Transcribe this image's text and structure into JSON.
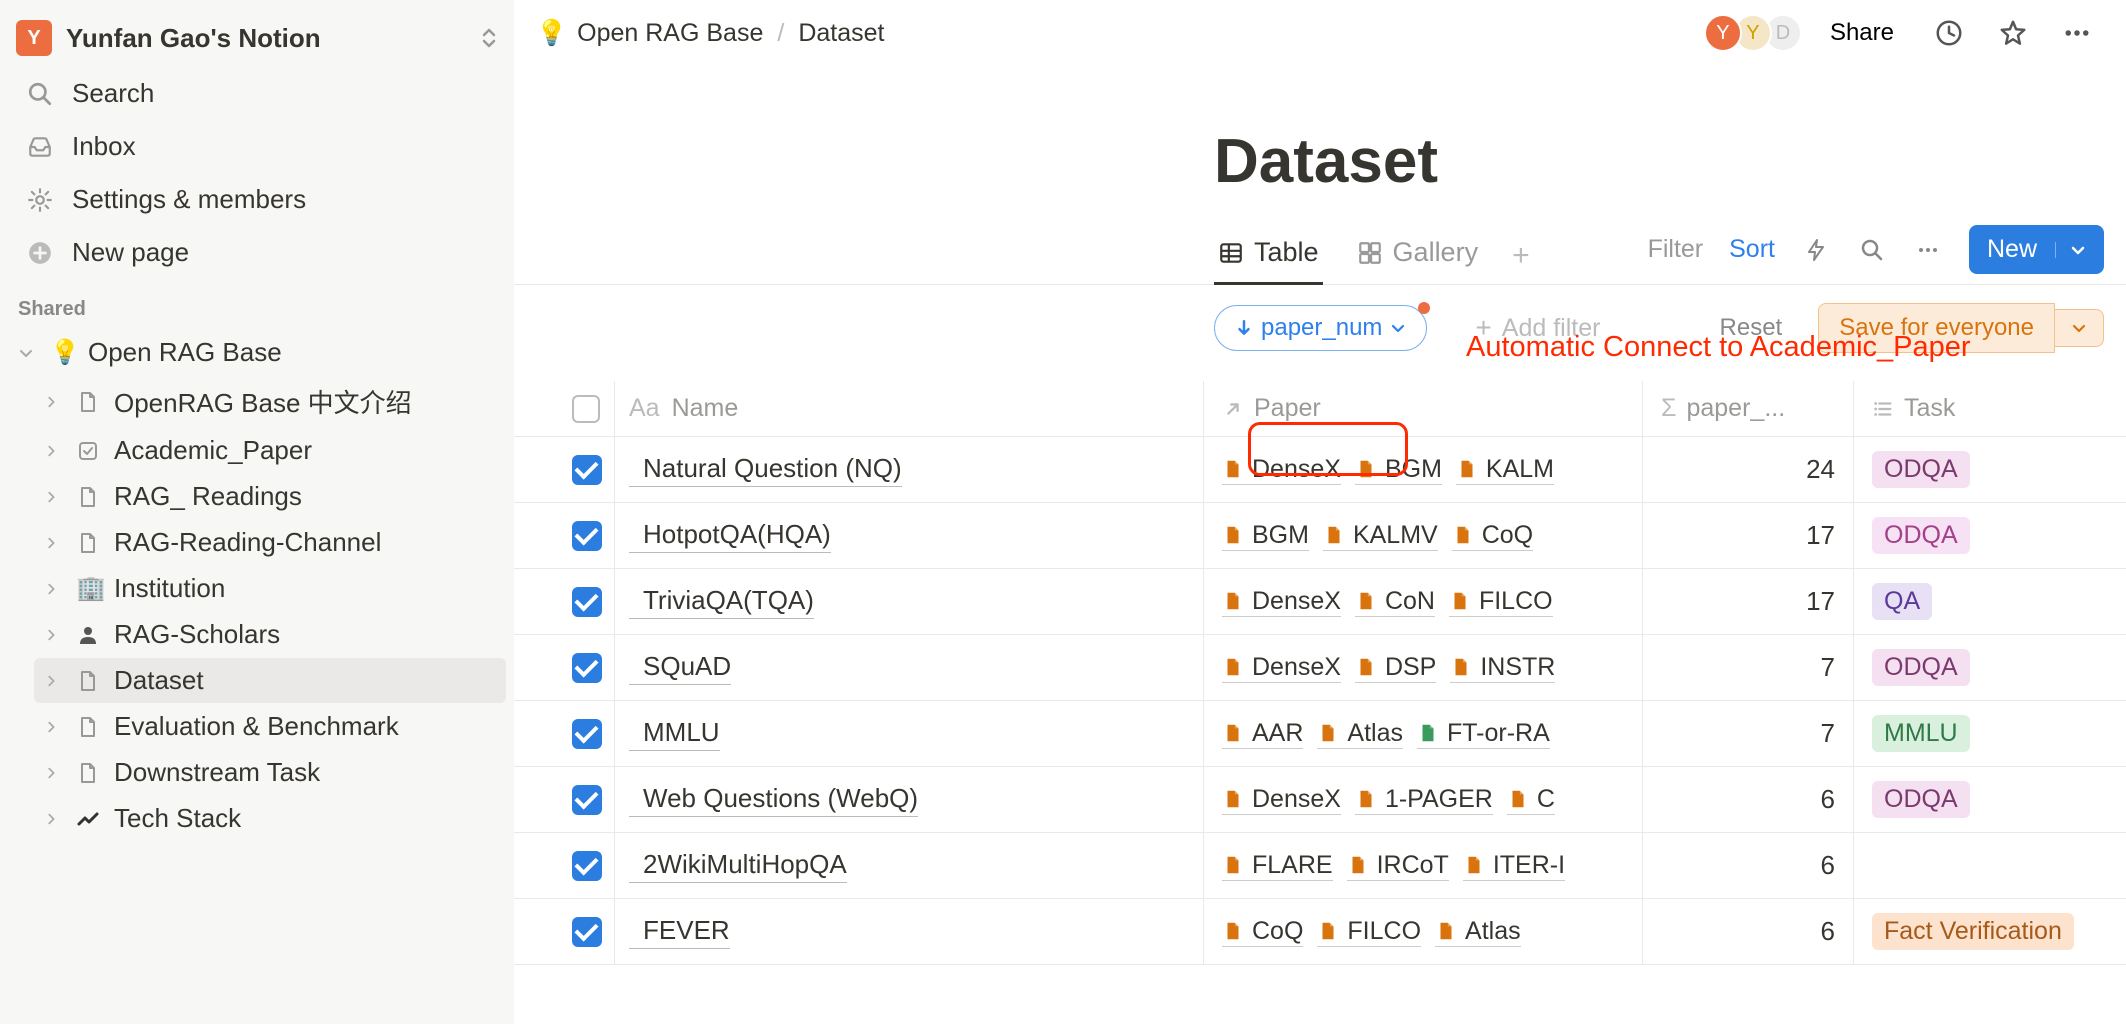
{
  "workspace": {
    "avatar_letter": "Y",
    "title": "Yunfan Gao's Notion"
  },
  "sidebar": {
    "search": "Search",
    "inbox": "Inbox",
    "settings": "Settings & members",
    "newpage": "New page",
    "shared_label": "Shared",
    "root": {
      "emoji": "💡",
      "label": "Open RAG Base"
    },
    "children": [
      {
        "icon": "page",
        "label": "OpenRAG Base 中文介绍"
      },
      {
        "icon": "check",
        "label": "Academic_Paper"
      },
      {
        "icon": "page",
        "label": "RAG_ Readings"
      },
      {
        "icon": "page",
        "label": "RAG-Reading-Channel"
      },
      {
        "icon": "🏢",
        "label": "Institution"
      },
      {
        "icon": "👤",
        "label": "RAG-Scholars"
      },
      {
        "icon": "page",
        "label": "Dataset",
        "selected": true
      },
      {
        "icon": "page",
        "label": "Evaluation & Benchmark"
      },
      {
        "icon": "page",
        "label": "Downstream Task"
      },
      {
        "icon": "📈",
        "label": "Tech Stack"
      }
    ]
  },
  "breadcrumb": {
    "emoji": "💡",
    "parent": "Open RAG Base",
    "current": "Dataset"
  },
  "topbar": {
    "share": "Share",
    "presence": [
      "Y",
      "Y",
      "D"
    ]
  },
  "page": {
    "title": "Dataset"
  },
  "views": {
    "table": "Table",
    "gallery": "Gallery",
    "filter": "Filter",
    "sort": "Sort",
    "new": "New"
  },
  "filters": {
    "sort_chip": "paper_num",
    "add_filter": "Add filter",
    "reset": "Reset",
    "save": "Save for everyone"
  },
  "annotation": "Automatic Connect to Academic_Paper",
  "columns": {
    "name": "Name",
    "paper": "Paper",
    "paper_num": "paper_...",
    "task": "Task"
  },
  "rows": [
    {
      "name": "Natural Question (NQ)",
      "papers": [
        "DenseX",
        "BGM",
        "KALM"
      ],
      "num": 24,
      "tags": [
        {
          "t": "ODQA",
          "cls": "tag-odqa"
        }
      ]
    },
    {
      "name": "HotpotQA(HQA)",
      "papers": [
        "BGM",
        "KALMV",
        "CoQ"
      ],
      "num": 17,
      "tags": [
        {
          "t": "ODQA",
          "cls": "tag-odqa2"
        }
      ]
    },
    {
      "name": "TriviaQA(TQA)",
      "papers": [
        "DenseX",
        "CoN",
        "FILCO"
      ],
      "num": 17,
      "tags": [
        {
          "t": "QA",
          "cls": "tag-qa"
        }
      ]
    },
    {
      "name": "SQuAD",
      "papers": [
        "DenseX",
        "DSP",
        "INSTR"
      ],
      "num": 7,
      "tags": [
        {
          "t": "ODQA",
          "cls": "tag-odqa"
        }
      ]
    },
    {
      "name": "MMLU",
      "papers": [
        "AAR",
        "Atlas",
        "FT-or-RA"
      ],
      "paper_icons": [
        "o",
        "o",
        "g"
      ],
      "num": 7,
      "tags": [
        {
          "t": "MMLU",
          "cls": "tag-mmlu"
        }
      ]
    },
    {
      "name": "Web Questions (WebQ)",
      "papers": [
        "DenseX",
        "1-PAGER",
        "C"
      ],
      "num": 6,
      "tags": [
        {
          "t": "ODQA",
          "cls": "tag-odqa"
        }
      ]
    },
    {
      "name": "2WikiMultiHopQA",
      "papers": [
        "FLARE",
        "IRCoT",
        "ITER-I"
      ],
      "num": 6,
      "tags": []
    },
    {
      "name": "FEVER",
      "papers": [
        "CoQ",
        "FILCO",
        "Atlas"
      ],
      "num": 6,
      "tags": [
        {
          "t": "Fact Verification",
          "cls": "tag-fact"
        }
      ]
    }
  ]
}
